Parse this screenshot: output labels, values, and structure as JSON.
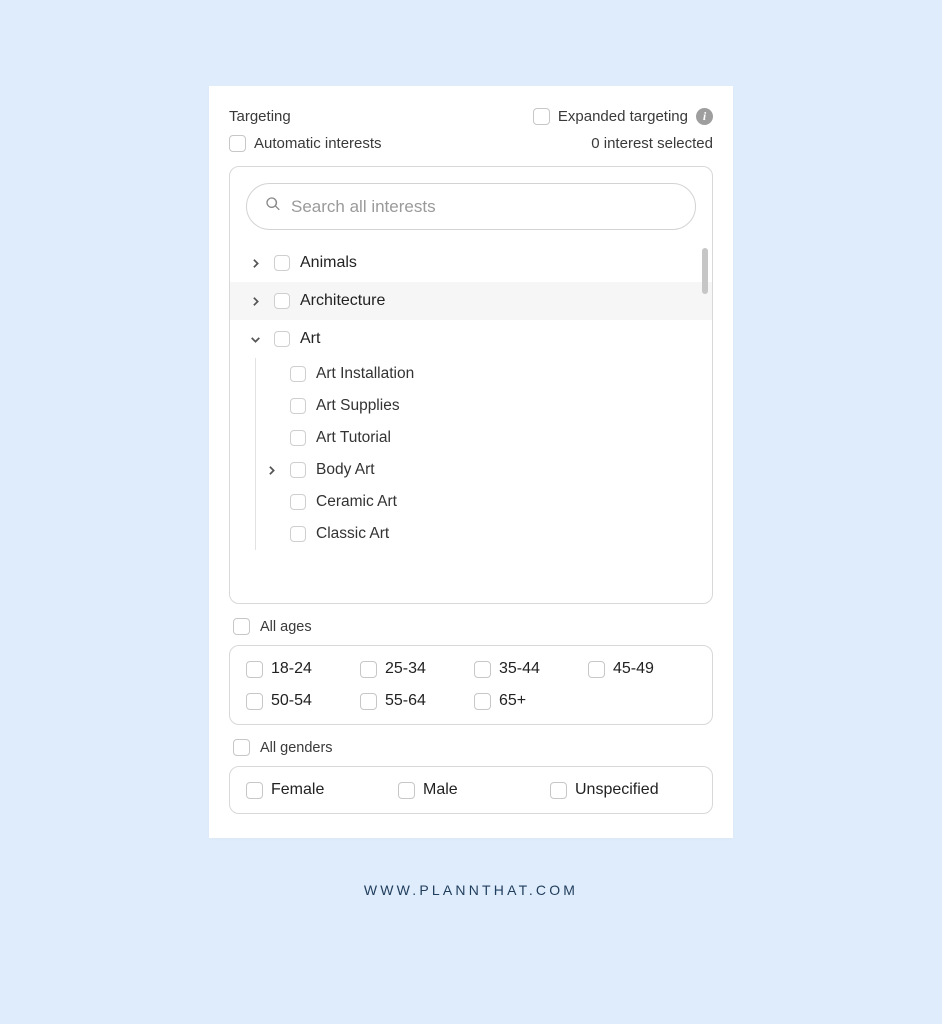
{
  "header": {
    "title": "Targeting",
    "expanded_label": "Expanded targeting"
  },
  "auto_interests_label": "Automatic interests",
  "selected_count_text": "0 interest selected",
  "search": {
    "placeholder": "Search all interests"
  },
  "tree": {
    "items": [
      {
        "label": "Animals",
        "expanded": false
      },
      {
        "label": "Architecture",
        "expanded": false,
        "hover": true
      },
      {
        "label": "Art",
        "expanded": true,
        "children": [
          {
            "label": "Art Installation"
          },
          {
            "label": "Art Supplies"
          },
          {
            "label": "Art Tutorial"
          },
          {
            "label": "Body Art",
            "has_children": true
          },
          {
            "label": "Ceramic Art"
          },
          {
            "label": "Classic Art"
          }
        ]
      }
    ]
  },
  "ages": {
    "all_label": "All ages",
    "options": [
      "18-24",
      "25-34",
      "35-44",
      "45-49",
      "50-54",
      "55-64",
      "65+"
    ]
  },
  "genders": {
    "all_label": "All genders",
    "options": [
      "Female",
      "Male",
      "Unspecified"
    ]
  },
  "footer_text": "WWW.PLANNTHAT.COM"
}
